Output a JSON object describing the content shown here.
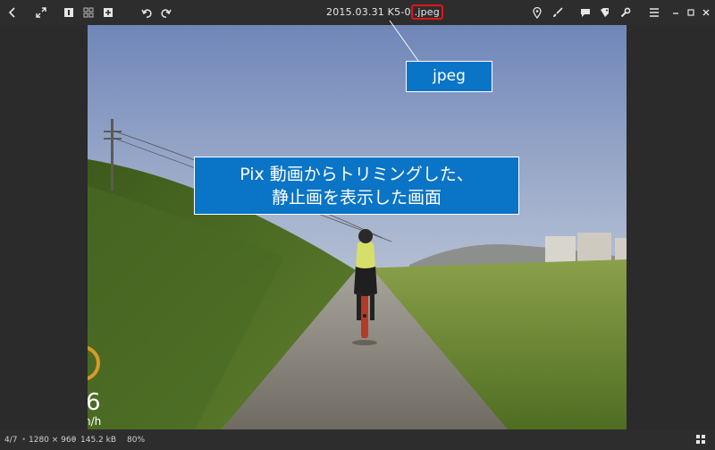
{
  "window": {
    "title_prefix": "2015.03.31 K5-0",
    "title_ext": ".jpeg"
  },
  "toolbar_left": [
    {
      "name": "back-arrow-icon"
    },
    {
      "name": "fullscreen-expand-icon"
    },
    {
      "name": "single-view-icon"
    },
    {
      "name": "grid-view-icon"
    },
    {
      "name": "add-icon"
    },
    {
      "name": "undo-icon"
    },
    {
      "name": "redo-icon"
    }
  ],
  "toolbar_right": [
    {
      "name": "location-pin-icon"
    },
    {
      "name": "brush-icon"
    },
    {
      "name": "comment-icon"
    },
    {
      "name": "tag-icon"
    },
    {
      "name": "wrench-icon"
    },
    {
      "name": "menu-icon"
    },
    {
      "name": "minimize-icon"
    },
    {
      "name": "maximize-icon"
    },
    {
      "name": "close-icon"
    }
  ],
  "annotations": {
    "ext_callout": "jpeg",
    "main_line1": "Pix 動画からトリミングした、",
    "main_line2": "静止画を表示した画面"
  },
  "overlay": {
    "speed": "6",
    "unit": "n/h"
  },
  "status": {
    "position": "4/7",
    "dimensions": "1280 × 960",
    "size": "145.2 kB",
    "zoom": "80%"
  },
  "colors": {
    "toolbar_bg": "#2d2d2d",
    "callout_bg": "#0a74c6",
    "highlight": "#e0141a"
  }
}
